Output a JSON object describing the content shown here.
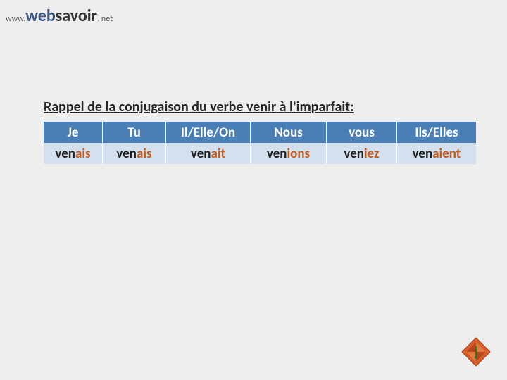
{
  "header": {
    "www": "www.",
    "web": "web",
    "savoir": "savoir",
    "net": ". net"
  },
  "title": {
    "prefix": "Rappel de la conjugaison du verbe ",
    "verb": "venir",
    "suffix": " à l'imparfait:"
  },
  "conjugation": [
    {
      "pronoun": "Je",
      "stem": "ven",
      "ending": "ais"
    },
    {
      "pronoun": "Tu",
      "stem": "ven",
      "ending": "ais"
    },
    {
      "pronoun": "Il/Elle/On",
      "stem": "ven",
      "ending": "ait"
    },
    {
      "pronoun": "Nous",
      "stem": "ven",
      "ending": "ions"
    },
    {
      "pronoun": "vous",
      "stem": "ven",
      "ending": "iez"
    },
    {
      "pronoun": "Ils/Elles",
      "stem": "ven",
      "ending": "aient"
    }
  ]
}
